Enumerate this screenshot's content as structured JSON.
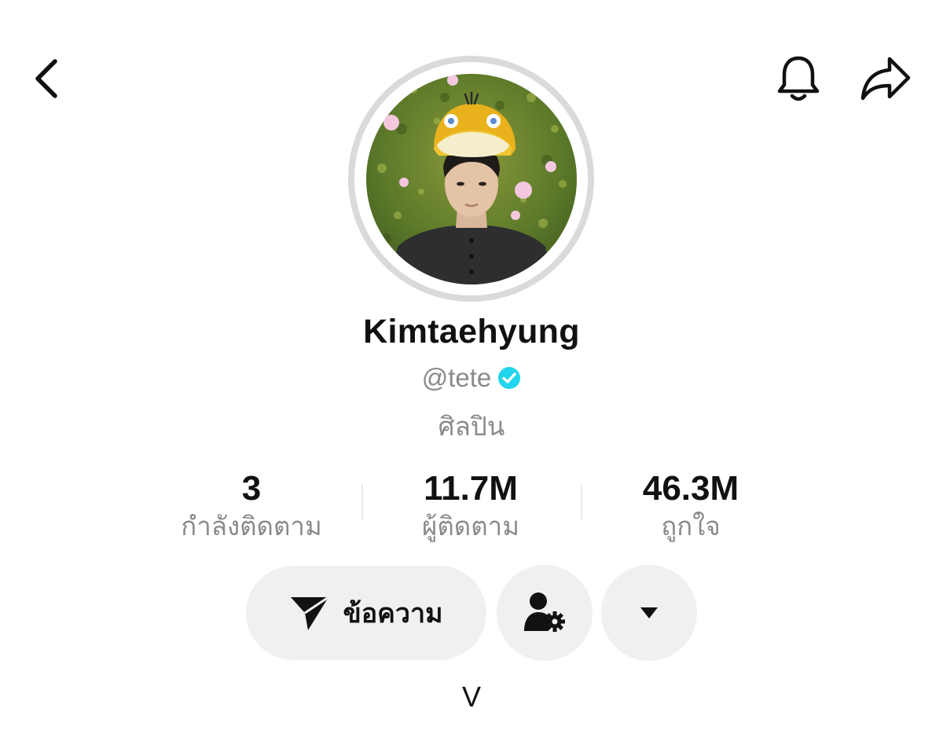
{
  "profile": {
    "display_name": "Kimtaehyung",
    "handle": "@tete",
    "verified": true,
    "category": "ศิลปิน",
    "bio": "V"
  },
  "stats": {
    "following": {
      "value": "3",
      "label": "กำลังติดตาม"
    },
    "followers": {
      "value": "11.7M",
      "label": "ผู้ติดตาม"
    },
    "likes": {
      "value": "46.3M",
      "label": "ถูกใจ"
    }
  },
  "actions": {
    "message_label": "ข้อความ"
  },
  "icons": {
    "back": "chevron-left-icon",
    "bell": "bell-icon",
    "share": "share-arrow-icon",
    "verified": "verified-check-icon",
    "message": "send-plane-icon",
    "friend_settings": "user-gear-icon",
    "more": "caret-down-icon"
  },
  "colors": {
    "verified_badge": "#20d5ec",
    "secondary_text": "#8a8a8a",
    "button_bg": "#f0f0f0"
  }
}
